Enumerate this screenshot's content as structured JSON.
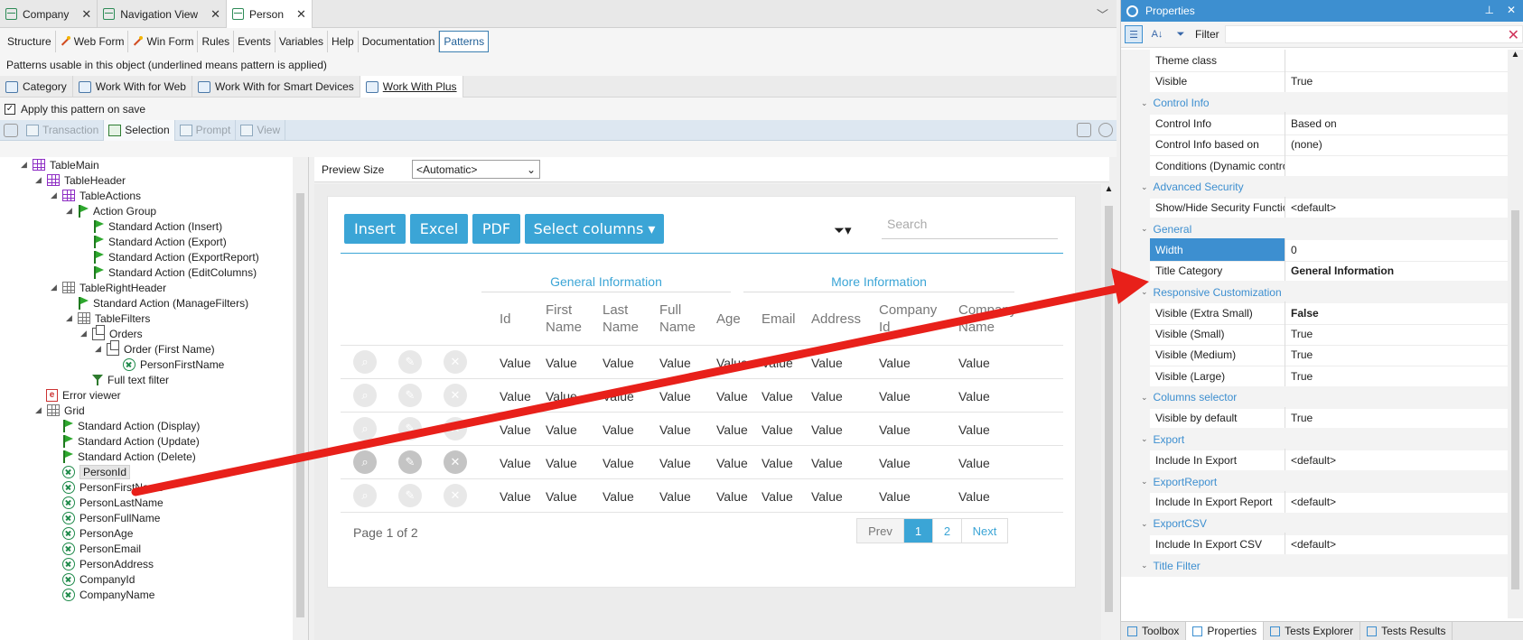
{
  "doc_tabs": [
    {
      "label": "Company"
    },
    {
      "label": "Navigation View"
    },
    {
      "label": "Person"
    }
  ],
  "sections": [
    "Structure",
    "Web Form",
    "Win Form",
    "Rules",
    "Events",
    "Variables",
    "Help",
    "Documentation",
    "Patterns"
  ],
  "patterns_caption": "Patterns usable in this object (underlined means pattern is applied)",
  "pattern_tabs": [
    "Category",
    "Work With for Web",
    "Work With for Smart Devices",
    "Work With Plus"
  ],
  "apply_label": "Apply this pattern on save",
  "apply_checked": "✓",
  "sub_tabs": [
    "Transaction",
    "Selection",
    "Prompt",
    "View"
  ],
  "tree": [
    "TableMain",
    "TableHeader",
    "TableActions",
    "Action Group",
    "Standard Action (Insert)",
    "Standard Action (Export)",
    "Standard Action (ExportReport)",
    "Standard Action (EditColumns)",
    "TableRightHeader",
    "Standard Action (ManageFilters)",
    "TableFilters",
    "Orders",
    "Order (First Name)",
    "PersonFirstName",
    "Full text filter",
    "Error viewer",
    "Grid",
    "Standard Action (Display)",
    "Standard Action (Update)",
    "Standard Action (Delete)",
    "PersonId",
    "PersonFirstName",
    "PersonLastName",
    "PersonFullName",
    "PersonAge",
    "PersonEmail",
    "PersonAddress",
    "CompanyId",
    "CompanyName"
  ],
  "preview": {
    "size_label": "Preview Size",
    "size_value": "<Automatic>",
    "buttons": [
      "Insert",
      "Excel",
      "PDF",
      "Select columns ▾"
    ],
    "search_placeholder": "Search",
    "group_general": "General Information",
    "group_more": "More Information",
    "columns": [
      "Id",
      "First\nName",
      "Last\nName",
      "Full\nName",
      "Age",
      "Email",
      "Address",
      "Company\nId",
      "Company\nName"
    ],
    "cell_value": "Value",
    "page_text": "Page 1 of 2",
    "pager": [
      "Prev",
      "1",
      "2",
      "Next"
    ]
  },
  "props": {
    "title": "Properties",
    "filter_label": "Filter",
    "rows": [
      {
        "type": "prop",
        "name": "Theme class",
        "value": ""
      },
      {
        "type": "prop",
        "name": "Visible",
        "value": "True"
      },
      {
        "type": "cat",
        "name": "Control Info"
      },
      {
        "type": "prop",
        "name": "Control Info",
        "value": "Based on"
      },
      {
        "type": "prop",
        "name": "Control Info based on",
        "value": "(none)"
      },
      {
        "type": "prop",
        "name": "Conditions (Dynamic contro",
        "value": ""
      },
      {
        "type": "cat",
        "name": "Advanced Security"
      },
      {
        "type": "prop",
        "name": "Show/Hide Security Functic",
        "value": "<default>"
      },
      {
        "type": "cat",
        "name": "General"
      },
      {
        "type": "prop",
        "name": "Width",
        "value": "0",
        "selected": true
      },
      {
        "type": "prop",
        "name": "Title Category",
        "value": "General Information",
        "bold": true
      },
      {
        "type": "cat",
        "name": "Responsive Customization"
      },
      {
        "type": "prop",
        "name": "Visible (Extra Small)",
        "value": "False",
        "bold": true
      },
      {
        "type": "prop",
        "name": "Visible (Small)",
        "value": "True"
      },
      {
        "type": "prop",
        "name": "Visible (Medium)",
        "value": "True"
      },
      {
        "type": "prop",
        "name": "Visible (Large)",
        "value": "True"
      },
      {
        "type": "cat",
        "name": "Columns selector"
      },
      {
        "type": "prop",
        "name": "Visible by default",
        "value": "True"
      },
      {
        "type": "cat",
        "name": "Export"
      },
      {
        "type": "prop",
        "name": "Include In Export",
        "value": "<default>"
      },
      {
        "type": "cat",
        "name": "ExportReport"
      },
      {
        "type": "prop",
        "name": "Include In Export Report",
        "value": "<default>"
      },
      {
        "type": "cat",
        "name": "ExportCSV"
      },
      {
        "type": "prop",
        "name": "Include In Export CSV",
        "value": "<default>"
      },
      {
        "type": "cat",
        "name": "Title Filter"
      }
    ],
    "bottom_tabs": [
      "Toolbox",
      "Properties",
      "Tests Explorer",
      "Tests Results"
    ]
  },
  "colors": {
    "accent": "#3ba5d6",
    "props_header": "#3d8fd0",
    "arrow": "#e8201a"
  }
}
